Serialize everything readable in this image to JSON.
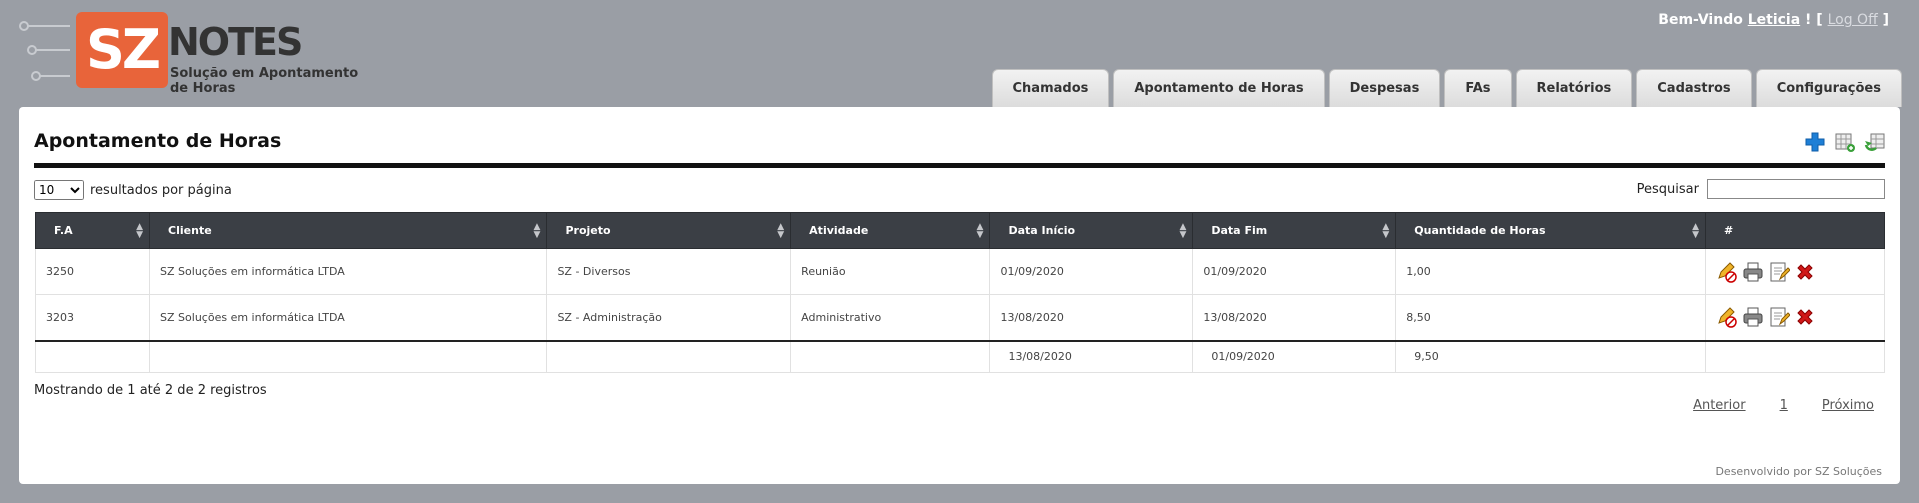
{
  "brand": {
    "logo_mark": "SZ",
    "logo_name": "NOTES",
    "tagline": "Solução em Apontamento de Horas"
  },
  "header": {
    "welcome": "Bem-Vindo",
    "user": "Leticia",
    "sep": "! [",
    "logoff": "Log Off",
    "close": "]"
  },
  "tabs": [
    "Chamados",
    "Apontamento de Horas",
    "Despesas",
    "FAs",
    "Relatórios",
    "Cadastros",
    "Configurações"
  ],
  "page": {
    "title": "Apontamento de Horas",
    "length_value": "10",
    "length_label": "resultados por página",
    "search_label": "Pesquisar",
    "search_value": ""
  },
  "table": {
    "columns": [
      "F.A",
      "Cliente",
      "Projeto",
      "Atividade",
      "Data Início",
      "Data Fim",
      "Quantidade de Horas",
      "#"
    ],
    "rows": [
      [
        "3250",
        "SZ Soluções em informática LTDA",
        "SZ - Diversos",
        "Reunião",
        "01/09/2020",
        "01/09/2020",
        "1,00"
      ],
      [
        "3203",
        "SZ Soluções em informática LTDA",
        "SZ - Administração",
        "Administrativo",
        "13/08/2020",
        "13/08/2020",
        "8,50"
      ]
    ],
    "footer": {
      "start": "13/08/2020",
      "end": "01/09/2020",
      "total": "9,50"
    },
    "row_icons": [
      "edit-pencil-icon",
      "print-icon",
      "notes-icon",
      "delete-icon"
    ]
  },
  "info": "Mostrando de 1 até 2 de 2 registros",
  "pager": {
    "prev": "Anterior",
    "page": "1",
    "next": "Próximo"
  },
  "footer": "Desenvolvido por SZ Soluções",
  "colors": {
    "header_bg": "#9a9ea5",
    "logo_orange": "#e8643a",
    "table_head": "#3b3f45",
    "delete_red": "#d01818",
    "add_blue": "#1e7fd6"
  }
}
